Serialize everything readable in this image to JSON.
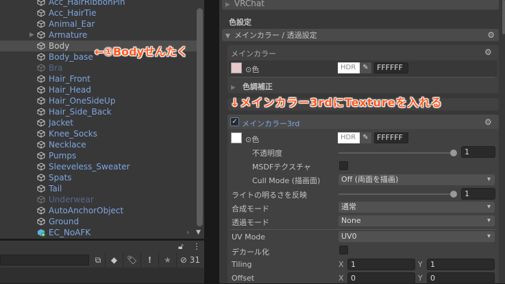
{
  "hierarchy": {
    "items": [
      {
        "label": "Acc_HairRibbonPin"
      },
      {
        "label": "Acc_HairTie"
      },
      {
        "label": "Animal_Ear"
      },
      {
        "label": "Armature",
        "expandable": true
      },
      {
        "label": "Body",
        "selected": true
      },
      {
        "label": "Body_base"
      },
      {
        "label": "Bra",
        "disabled": true
      },
      {
        "label": "Hair_Front"
      },
      {
        "label": "Hair_Head"
      },
      {
        "label": "Hair_OneSideUp"
      },
      {
        "label": "Hair_Side_Back"
      },
      {
        "label": "Jacket"
      },
      {
        "label": "Knee_Socks"
      },
      {
        "label": "Necklace"
      },
      {
        "label": "Pumps"
      },
      {
        "label": "Sleeveless_Sweater"
      },
      {
        "label": "Spats"
      },
      {
        "label": "Tail"
      },
      {
        "label": "Underwear",
        "disabled": true
      },
      {
        "label": "AutoAnchorObject"
      },
      {
        "label": "Ground"
      },
      {
        "label": "EC_NoAFK",
        "prefab": true
      }
    ],
    "annotation": "←①Bodyせんたく",
    "hidden_count": "31"
  },
  "inspector": {
    "vrchat": "VRChat",
    "color_settings": "色設定",
    "section": "メインカラー / 透過設定",
    "main_color": {
      "title": "メインカラー",
      "color_label": "⊙色",
      "hdr": "HDR",
      "hex": "FFFFFF",
      "tone": "色調補正"
    },
    "annotation": "↓メインカラー3rdにTextureを入れる",
    "third": {
      "title": "メインカラー3rd",
      "color_label": "⊙色",
      "hdr": "HDR",
      "hex": "FFFFFF",
      "opacity_label": "不透明度",
      "opacity": "1",
      "msdf_label": "MSDFテクスチャ",
      "cull_label": "Cull Mode (描画面)",
      "cull": "Off (両面を描画)",
      "light_label": "ライトの明るさを反映",
      "light": "1",
      "blend_label": "合成モード",
      "blend": "通常",
      "alpha_label": "透過モード",
      "alpha": "None",
      "uv_label": "UV Mode",
      "uv": "UV0",
      "decal_label": "デカール化",
      "tiling_label": "Tiling",
      "tiling_x": "1",
      "tiling_y": "1",
      "offset_label": "Offset",
      "offset_x": "0",
      "offset_y": "0",
      "x": "X",
      "y": "Y"
    }
  }
}
